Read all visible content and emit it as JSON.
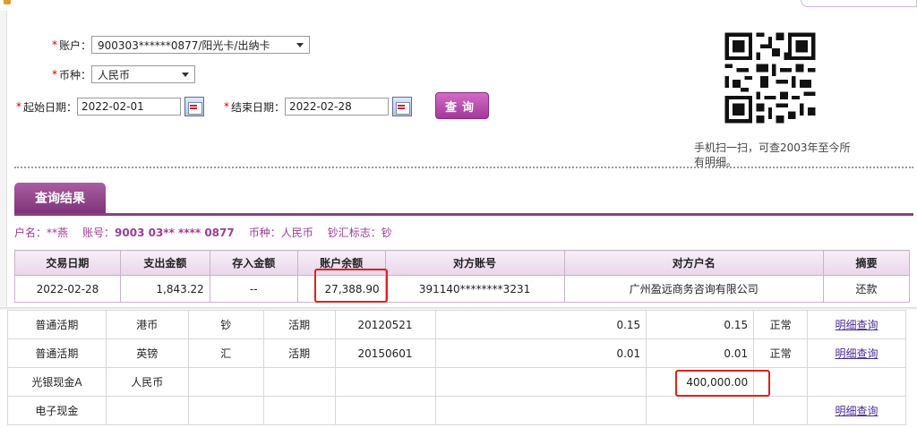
{
  "form": {
    "account_label": "账户：",
    "account_value": "900303******0877/阳光卡/出纳卡",
    "currency_label": "币种：",
    "currency_value": "人民币",
    "start_label": "起始日期：",
    "start_value": "2022-02-01",
    "end_label": "结束日期：",
    "end_value": "2022-02-28",
    "query_button": "查询",
    "qr_note": "手机扫一扫，可查2003年至今所有明细。"
  },
  "results": {
    "tab_label": "查询结果",
    "name_label": "户名：",
    "name_value": "**燕",
    "acct_label": "账号：",
    "acct_value": "9003 03** **** 0877",
    "currency_label": "币种：",
    "currency_value": "人民币",
    "cash_label": "钞汇标志：",
    "cash_value": "钞",
    "headers": [
      "交易日期",
      "支出金额",
      "存入金额",
      "账户余额",
      "对方账号",
      "对方户名",
      "摘要"
    ],
    "rows": [
      [
        "2022-02-28",
        "1,843.22",
        "--",
        "27,388.90",
        "391140********3231",
        "广州盈远商务咨询有限公司",
        "还款"
      ]
    ]
  },
  "accounts": {
    "link_label": "明细查询",
    "rows": [
      {
        "name": "普通活期",
        "currency": "港币",
        "flag": "钞",
        "type": "活期",
        "date": "20120521",
        "balance1": "0.15",
        "balance2": "0.15",
        "status": "正常",
        "has_link": true
      },
      {
        "name": "普通活期",
        "currency": "英镑",
        "flag": "汇",
        "type": "活期",
        "date": "20150601",
        "balance1": "0.01",
        "balance2": "0.01",
        "status": "正常",
        "has_link": true
      },
      {
        "name": "光银现金A",
        "currency": "人民币",
        "flag": "",
        "type": "",
        "date": "",
        "balance1": "",
        "balance2": "400,000.00",
        "status": "",
        "has_link": false
      },
      {
        "name": "电子现金",
        "currency": "",
        "flag": "",
        "type": "",
        "date": "",
        "balance1": "",
        "balance2": "",
        "status": "",
        "has_link": true
      }
    ]
  },
  "colors": {
    "brand_purple": "#8c3f86",
    "highlight_red": "#e02020"
  }
}
